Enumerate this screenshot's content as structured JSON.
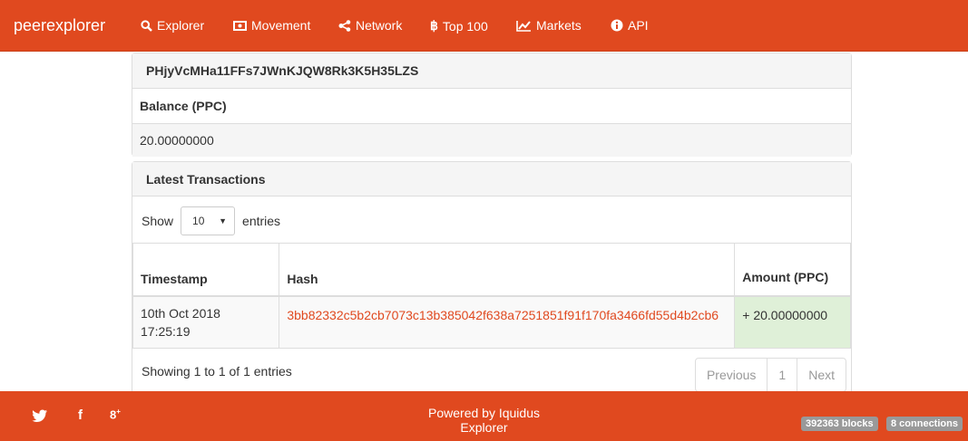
{
  "nav": {
    "brand": "peerexplorer",
    "items": [
      {
        "label": "Explorer",
        "icon": "search-icon"
      },
      {
        "label": "Movement",
        "icon": "money-icon"
      },
      {
        "label": "Network",
        "icon": "share-icon"
      },
      {
        "label": "Top 100",
        "icon": "bitcoin-icon"
      },
      {
        "label": "Markets",
        "icon": "line-chart-icon"
      },
      {
        "label": "API",
        "icon": "info-circle-icon"
      }
    ]
  },
  "address": {
    "id": "PHjyVcMHa11FFs7JWnKJQW8Rk3K5H35LZS",
    "balance_label": "Balance (PPC)",
    "balance_value": "20.00000000"
  },
  "transactions": {
    "title": "Latest Transactions",
    "show_label": "Show",
    "entries_label": "entries",
    "page_size": "10",
    "columns": [
      "Timestamp",
      "Hash",
      "Amount (PPC)"
    ],
    "rows": [
      {
        "timestamp_date": "10th Oct 2018",
        "timestamp_time": "17:25:19",
        "hash": "3bb82332c5b2cb7073c13b385042f638a7251851f91f170fa3466fd55d4b2cb6",
        "amount": "+ 20.00000000"
      }
    ],
    "info": "Showing 1 to 1 of 1 entries",
    "pager": {
      "previous": "Previous",
      "page": "1",
      "next": "Next"
    }
  },
  "footer": {
    "powered_line1": "Powered by Iquidus",
    "powered_line2": "Explorer",
    "blocks": "392363 blocks",
    "connections": "8 connections"
  },
  "colors": {
    "accent": "#e0491f",
    "success_bg": "#dff0d8"
  }
}
